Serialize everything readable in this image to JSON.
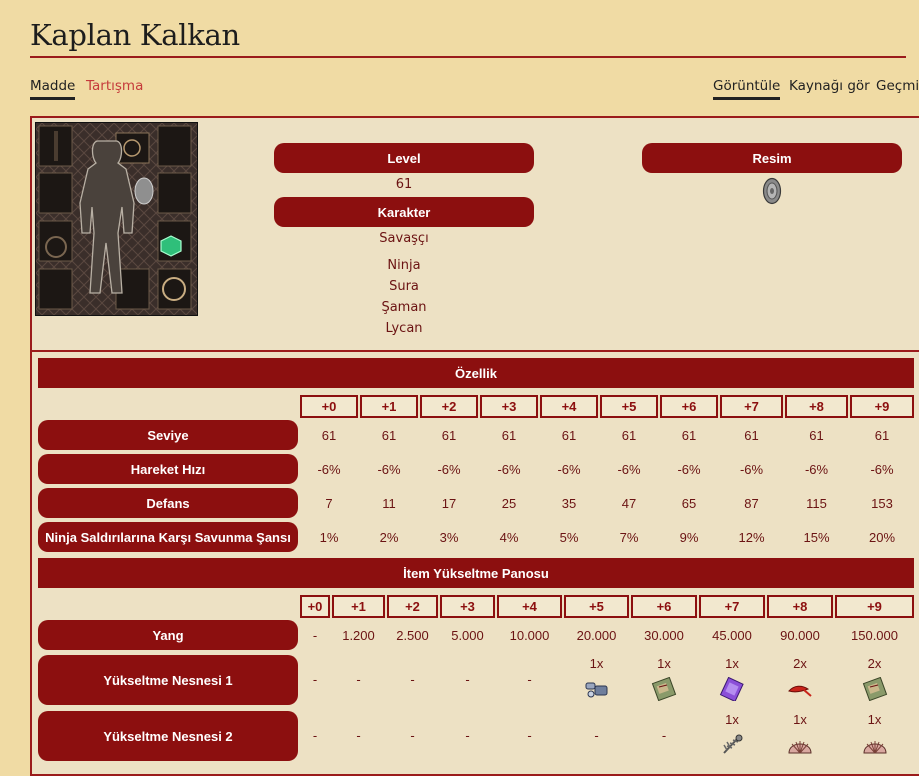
{
  "page": {
    "title": "Kaplan Kalkan",
    "tabs_left": [
      "Madde",
      "Tartışma"
    ],
    "tabs_right": [
      "Görüntüle",
      "Kaynağı gör",
      "Geçmiş"
    ]
  },
  "info": {
    "level_label": "Level",
    "level_value": "61",
    "character_label": "Karakter",
    "character_values": [
      "Savaşçı",
      "Ninja",
      "Sura",
      "Şaman",
      "Lycan"
    ],
    "image_label": "Resim"
  },
  "attributes": {
    "header": "Özellik",
    "levels": [
      "+0",
      "+1",
      "+2",
      "+3",
      "+4",
      "+5",
      "+6",
      "+7",
      "+8",
      "+9"
    ],
    "rows": [
      {
        "label": "Seviye",
        "values": [
          "61",
          "61",
          "61",
          "61",
          "61",
          "61",
          "61",
          "61",
          "61",
          "61"
        ]
      },
      {
        "label": "Hareket Hızı",
        "values": [
          "-6%",
          "-6%",
          "-6%",
          "-6%",
          "-6%",
          "-6%",
          "-6%",
          "-6%",
          "-6%",
          "-6%"
        ]
      },
      {
        "label": "Defans",
        "values": [
          "7",
          "11",
          "17",
          "25",
          "35",
          "47",
          "65",
          "87",
          "115",
          "153"
        ]
      },
      {
        "label": "Ninja Saldırılarına Karşı Savunma Şansı",
        "values": [
          "1%",
          "2%",
          "3%",
          "4%",
          "5%",
          "7%",
          "9%",
          "12%",
          "15%",
          "20%"
        ]
      }
    ]
  },
  "upgrade": {
    "header": "İtem Yükseltme Panosu",
    "levels": [
      "+0",
      "+1",
      "+2",
      "+3",
      "+4",
      "+5",
      "+6",
      "+7",
      "+8",
      "+9"
    ],
    "yang": {
      "label": "Yang",
      "values": [
        "-",
        "1.200",
        "2.500",
        "5.000",
        "10.000",
        "20.000",
        "30.000",
        "45.000",
        "90.000",
        "150.000"
      ]
    },
    "material1": {
      "label": "Yükseltme Nesnesi 1",
      "values": [
        "-",
        "-",
        "-",
        "-",
        "-",
        "1x",
        "1x",
        "1x",
        "2x",
        "2x"
      ],
      "icons": [
        "",
        "",
        "",
        "",
        "",
        "bracelet-piece-icon",
        "scroll-book-icon",
        "purple-scroll-icon",
        "red-feather-icon",
        "scroll-book-icon"
      ]
    },
    "material2": {
      "label": "Yükseltme Nesnesi 2",
      "values": [
        "-",
        "-",
        "-",
        "-",
        "-",
        "-",
        "-",
        "1x",
        "1x",
        "1x"
      ],
      "icons": [
        "",
        "",
        "",
        "",
        "",
        "",
        "",
        "fish-bone-icon",
        "shell-icon",
        "shell-icon"
      ]
    }
  }
}
